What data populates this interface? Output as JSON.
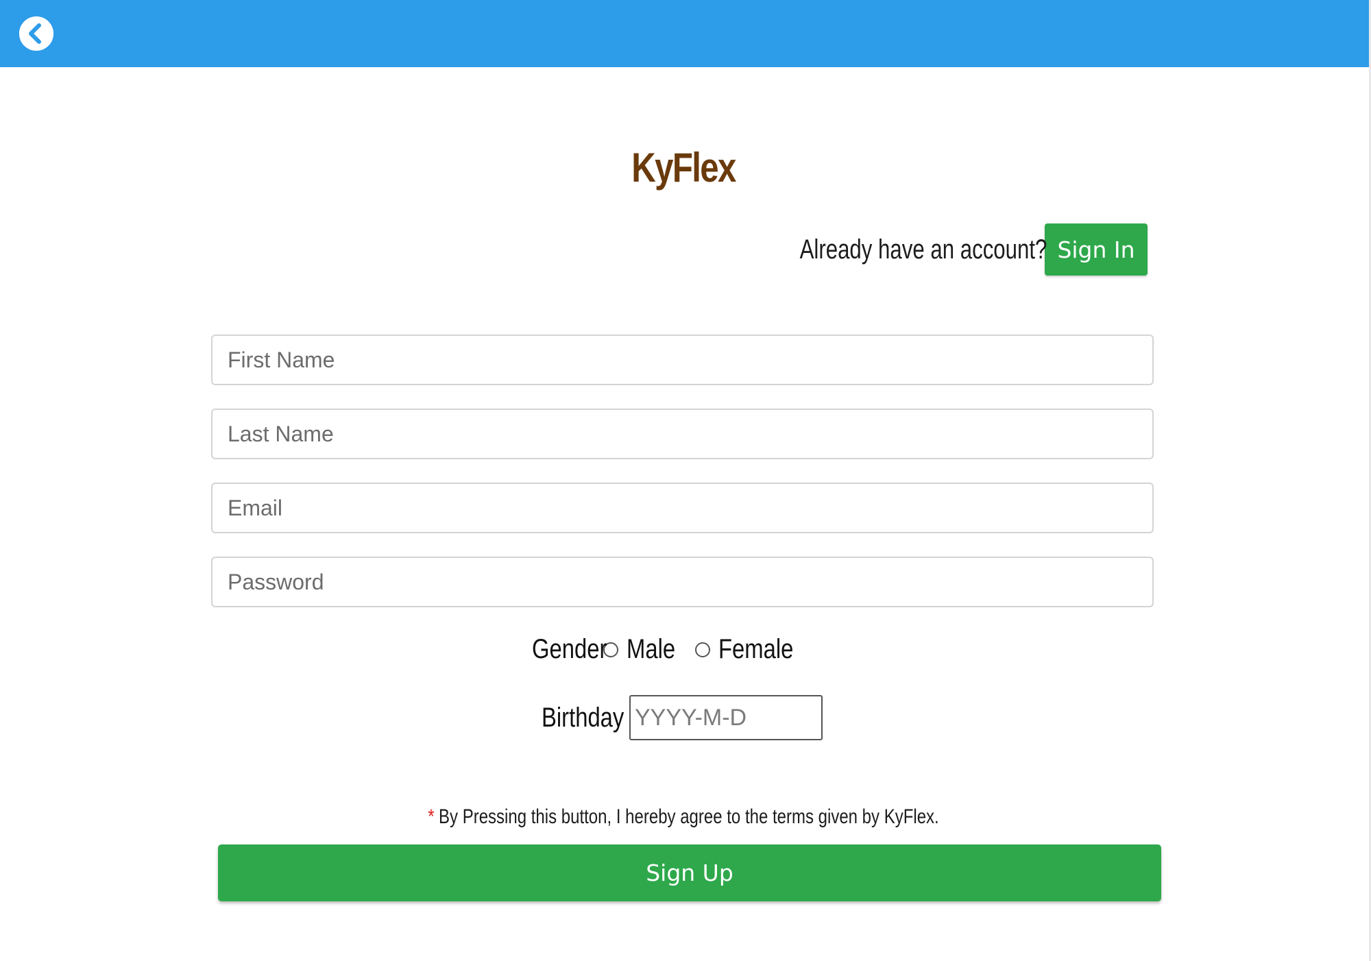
{
  "app": {
    "title": "KyFlex",
    "header_color": "#2d9ce9",
    "title_color": "#6a3a0c",
    "button_color": "#2ea84b"
  },
  "header": {
    "back_icon": "chevron-left-circle-icon"
  },
  "account": {
    "prompt": "Already have an account?",
    "signin_label": "Sign In"
  },
  "form": {
    "first_name": {
      "placeholder": "First Name",
      "value": ""
    },
    "last_name": {
      "placeholder": "Last Name",
      "value": ""
    },
    "email": {
      "placeholder": "Email",
      "value": ""
    },
    "password": {
      "placeholder": "Password",
      "value": ""
    },
    "gender": {
      "label": "Gender",
      "options": [
        "Male",
        "Female"
      ],
      "selected": ""
    },
    "birthday": {
      "label": "Birthday",
      "placeholder": "YYYY-M-D",
      "value": ""
    },
    "terms": {
      "marker": "*",
      "text": "By Pressing this button, I hereby agree to the terms given by KyFlex."
    },
    "signup_label": "Sign Up"
  }
}
